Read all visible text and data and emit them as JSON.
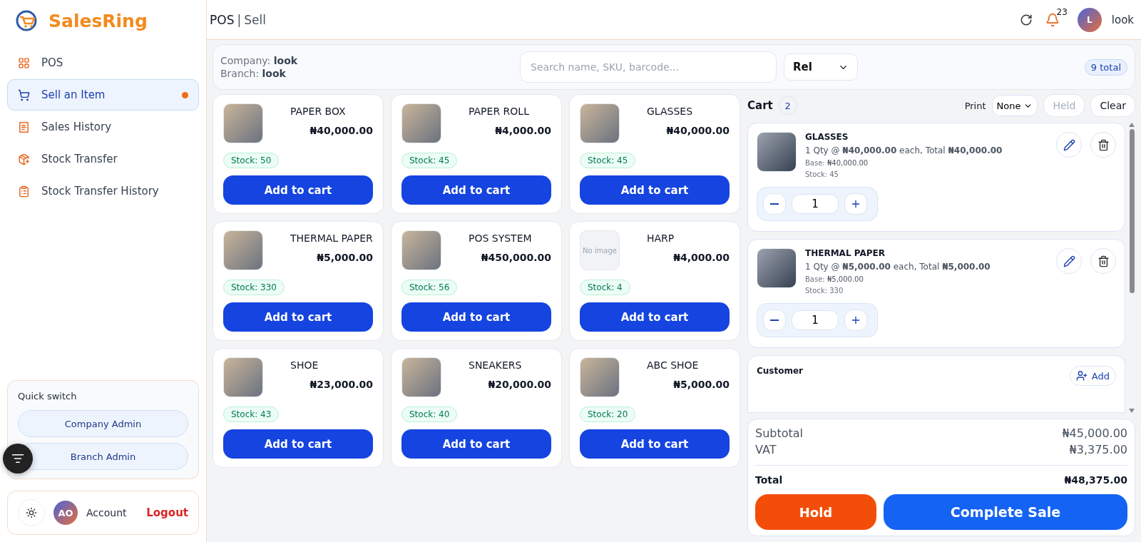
{
  "brand": {
    "name": "SalesRing"
  },
  "sidebar": {
    "items": [
      {
        "label": "POS",
        "kind": "grid",
        "selected": false,
        "has_dot": false
      },
      {
        "label": "Sell an Item",
        "kind": "cart",
        "selected": true,
        "has_dot": true
      },
      {
        "label": "Sales History",
        "kind": "receipt",
        "selected": false,
        "has_dot": false
      },
      {
        "label": "Stock Transfer",
        "kind": "box",
        "selected": false,
        "has_dot": false
      },
      {
        "label": "Stock Transfer History",
        "kind": "clipboard",
        "selected": false,
        "has_dot": false
      }
    ],
    "quick_switch": {
      "title": "Quick switch",
      "buttons": [
        "Company Admin",
        "Branch Admin"
      ]
    },
    "account": {
      "initials": "AO",
      "label": "Account",
      "logout": "Logout"
    }
  },
  "header": {
    "title": "POS",
    "separator": "|",
    "subtitle": "Sell",
    "notification_count": "23",
    "user_initial": "L",
    "user_name": "look"
  },
  "info_bar": {
    "company_label": "Company:",
    "company": "look",
    "branch_label": "Branch:",
    "branch": "look",
    "search": {
      "placeholder": "Search name, SKU, barcode..."
    },
    "sort": "Rel",
    "total": "9 total"
  },
  "products": [
    {
      "name": "PAPER BOX",
      "price": "₦40,000.00",
      "stock": "Stock: 50",
      "kind": "photo",
      "button": "Add to cart"
    },
    {
      "name": "PAPER ROLL",
      "price": "₦4,000.00",
      "stock": "Stock: 45",
      "kind": "photo",
      "button": "Add to cart"
    },
    {
      "name": "GLASSES",
      "price": "₦40,000.00",
      "stock": "Stock: 45",
      "kind": "photo",
      "button": "Add to cart"
    },
    {
      "name": "THERMAL PAPER",
      "price": "₦5,000.00",
      "stock": "Stock: 330",
      "kind": "photo",
      "button": "Add to cart"
    },
    {
      "name": "POS SYSTEM",
      "price": "₦450,000.00",
      "stock": "Stock: 56",
      "kind": "photo",
      "button": "Add to cart"
    },
    {
      "name": "HARP",
      "price": "₦4,000.00",
      "stock": "Stock: 4",
      "kind": "none",
      "image_text": "No image",
      "button": "Add to cart"
    },
    {
      "name": "SHOE",
      "price": "₦23,000.00",
      "stock": "Stock: 43",
      "kind": "photo",
      "button": "Add to cart"
    },
    {
      "name": "SNEAKERS",
      "price": "₦20,000.00",
      "stock": "Stock: 40",
      "kind": "photo",
      "button": "Add to cart"
    },
    {
      "name": "ABC SHOE",
      "price": "₦5,000.00",
      "stock": "Stock: 20",
      "kind": "photo",
      "button": "Add to cart"
    }
  ],
  "cart": {
    "title": "Cart",
    "count": "2",
    "print_label": "Print",
    "print_option": "None",
    "held": "Held",
    "held_disabled": true,
    "clear": "Clear",
    "items": [
      {
        "name": "GLASSES",
        "line": "1 Qty @ **₦40,000.00** each, Total **₦40,000.00**",
        "base": "Base: **₦40,000.00**",
        "stock": "Stock: 45",
        "quantity": "1"
      },
      {
        "name": "THERMAL PAPER",
        "line": "1 Qty @ **₦5,000.00** each, Total **₦5,000.00**",
        "base": "Base: **₦5,000.00**",
        "stock": "Stock: 330",
        "quantity": "1"
      }
    ],
    "customer": {
      "label": "Customer",
      "button": "Add"
    },
    "summary": [
      {
        "label": "Subtotal",
        "value": "₦45,000.00",
        "kind": "line"
      },
      {
        "label": "VAT",
        "value": "₦3,375.00",
        "kind": "line"
      },
      {
        "label": "Total",
        "value": "₦48,375.00",
        "kind": "total"
      }
    ],
    "hold": "Hold",
    "complete": "Complete Sale"
  }
}
